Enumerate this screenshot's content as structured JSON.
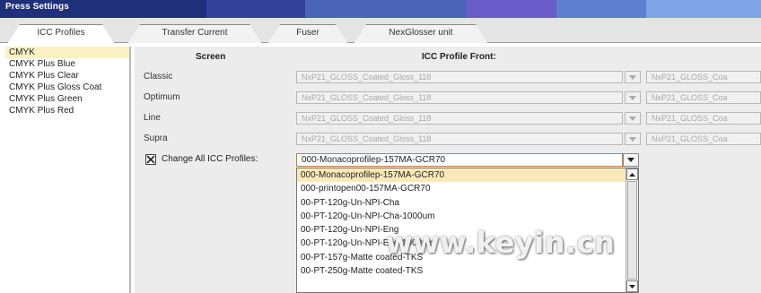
{
  "window": {
    "title": "Press Settings",
    "title_bar_colors": [
      "#1f2f7a",
      "#33419a",
      "#4a64b8",
      "#6a5cc8",
      "#5f7fd0",
      "#7ea3e6"
    ]
  },
  "tabs": [
    {
      "label": "ICC Profiles",
      "active": true
    },
    {
      "label": "Transfer Current",
      "active": false
    },
    {
      "label": "Fuser",
      "active": false
    },
    {
      "label": "NexGlosser unit",
      "active": false
    }
  ],
  "left_list": {
    "items": [
      "CMYK",
      "CMYK Plus Blue",
      "CMYK Plus Clear",
      "CMYK Plus Gloss Coat",
      "CMYK Plus Green",
      "CMYK Plus Red"
    ],
    "selected": "CMYK"
  },
  "main": {
    "screen_header": "Screen",
    "profile_front_header": "ICC Profile Front:",
    "rows": [
      {
        "label": "Classic",
        "value": "NxP21_GLOSS_Coated_Gloss_118",
        "value2": "NxP21_GLOSS_Coa"
      },
      {
        "label": "Optimum",
        "value": "NxP21_GLOSS_Coated_Gloss_118",
        "value2": "NxP21_GLOSS_Coa"
      },
      {
        "label": "Line",
        "value": "NxP21_GLOSS_Coated_Gloss_118",
        "value2": "NxP21_GLOSS_Coa"
      },
      {
        "label": "Supra",
        "value": "NxP21_GLOSS_Coated_Gloss_118",
        "value2": "NxP21_GLOSS_Coa"
      }
    ],
    "change_all": {
      "label": "Change All ICC Profiles:",
      "checked": true,
      "selected_value": "000-Monacoprofilep-157MA-GCR70"
    },
    "dropdown_options": [
      "000-Monacoprofilep-157MA-GCR70",
      "000-printopen00-157MA-GCR70",
      "00-PT-120g-Un-NPI-Cha",
      "00-PT-120g-Un-NPI-Cha-1000um",
      "00-PT-120g-Un-NPI-Eng",
      "00-PT-120g-Un-NPI-Eng-1000um",
      "00-PT-157g-Matte coated-TKS",
      "00-PT-250g-Matte coated-TKS"
    ]
  },
  "watermark": "www.keyin.cn"
}
